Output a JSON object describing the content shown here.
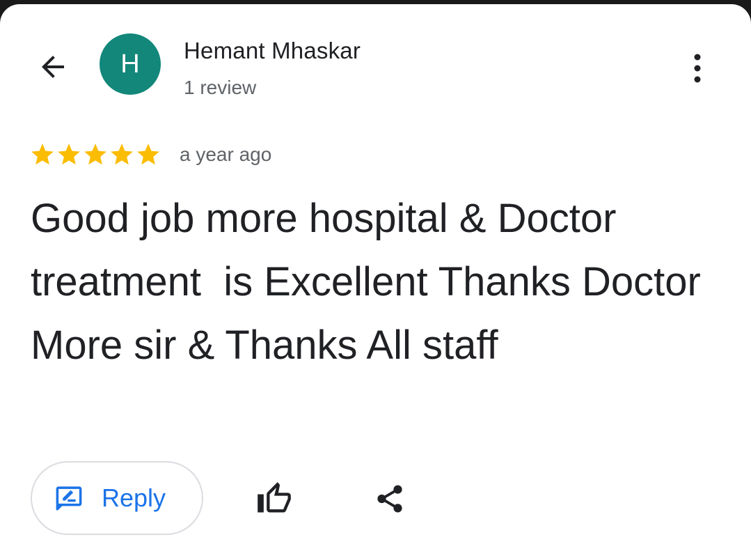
{
  "reviewer": {
    "name": "Hemant Mhaskar",
    "avatar_initial": "H",
    "avatar_color": "#12877a",
    "review_count": "1 review"
  },
  "review": {
    "rating": 5,
    "max_rating": 5,
    "star_color": "#fbbc04",
    "time": "a year ago",
    "text": "Good job more hospital & Doctor treatment  is Excellent Thanks Doctor  More sir & Thanks All staff"
  },
  "actions": {
    "reply_label": "Reply",
    "accent_color": "#1a73e8"
  },
  "icons": {
    "back": "arrow-left-icon",
    "more": "more-vertical-icon",
    "reply": "reply-edit-icon",
    "like": "thumbs-up-icon",
    "share": "share-icon"
  }
}
